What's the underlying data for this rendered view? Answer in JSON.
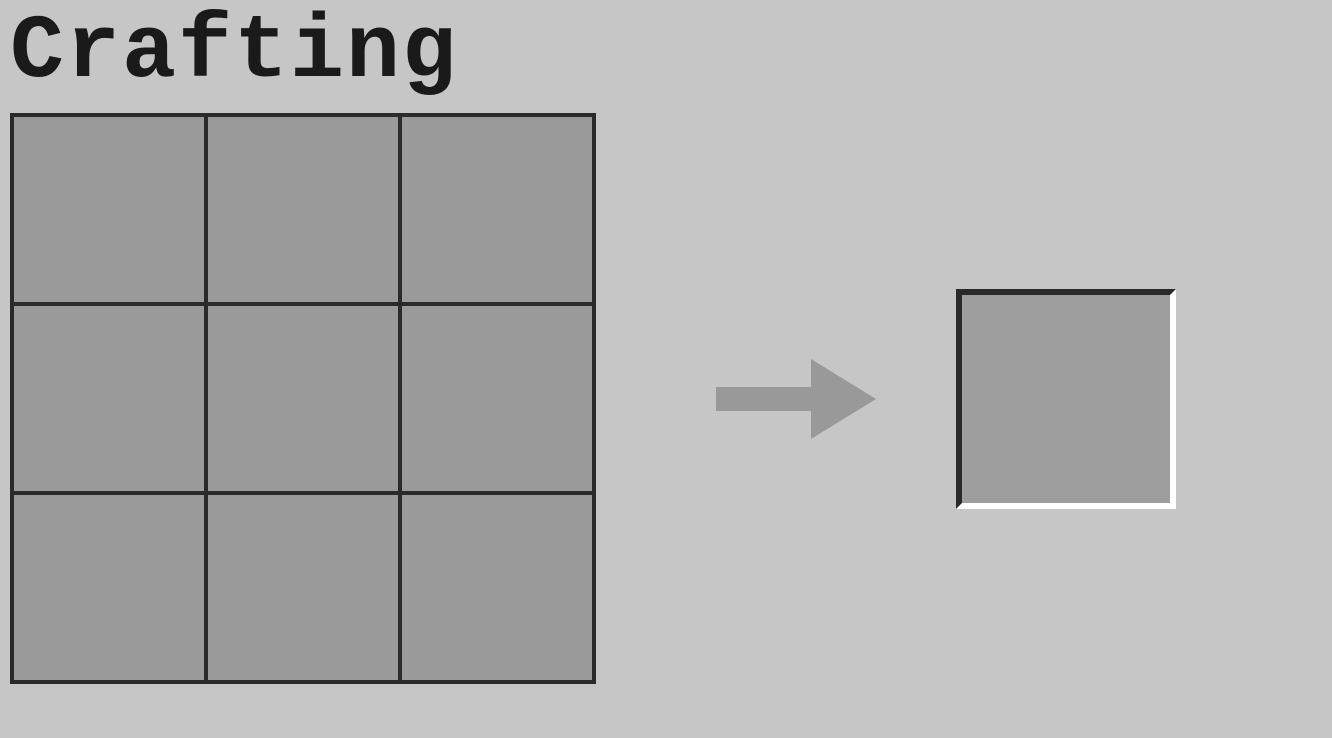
{
  "title": "Crafting",
  "grid": {
    "cells": [
      {
        "id": 0
      },
      {
        "id": 1
      },
      {
        "id": 2
      },
      {
        "id": 3
      },
      {
        "id": 4
      },
      {
        "id": 5
      },
      {
        "id": 6
      },
      {
        "id": 7
      },
      {
        "id": 8
      }
    ]
  },
  "arrow": {
    "label": "arrow-right-icon"
  },
  "result": {
    "label": "result-slot"
  },
  "colors": {
    "background": "#c6c6c6",
    "grid_bg": "#2a2a2a",
    "cell_bg": "#9a9a9a",
    "result_bg": "#9e9e9e",
    "arrow_color": "#999999",
    "title_color": "#1a1a1a"
  }
}
